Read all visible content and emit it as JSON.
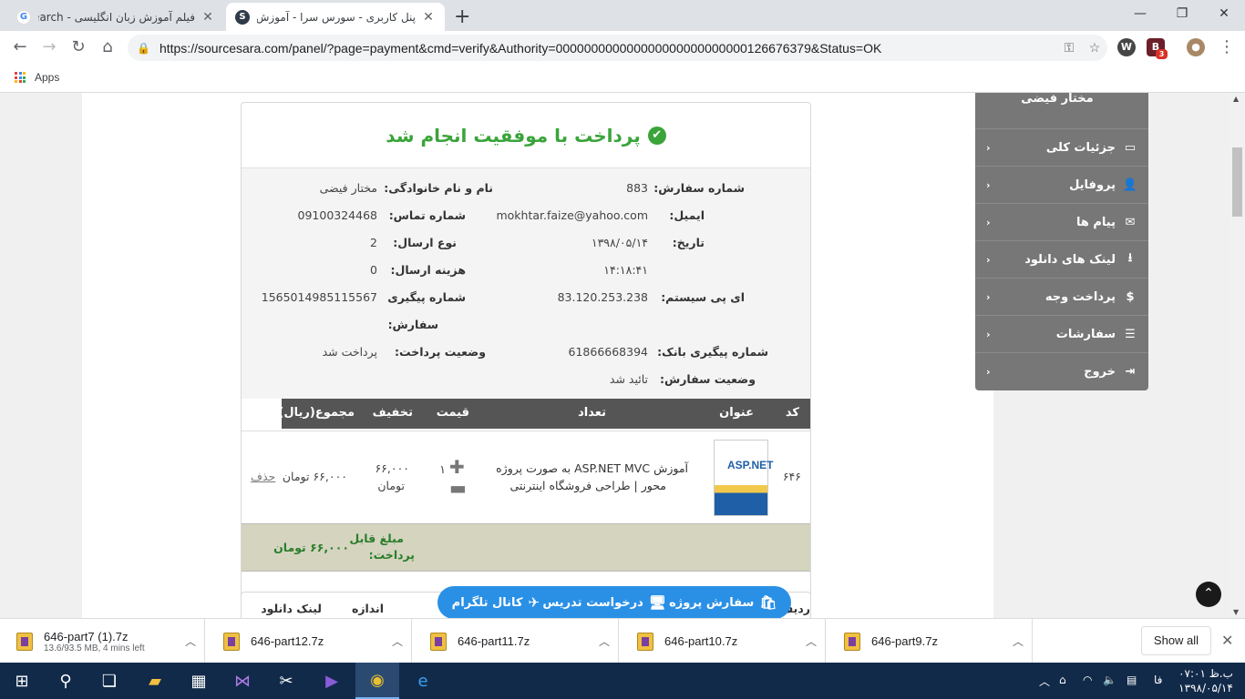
{
  "browser": {
    "tabs": [
      {
        "title": "فیلم آموزش زبان انگلیسی - Search",
        "icon": "google-icon"
      },
      {
        "title": "پنل کاربری - سورس سرا - آموزش برنامه نویسی",
        "icon": "sourcesara-icon"
      }
    ],
    "new_tab": "+",
    "url": "https://sourcesara.com/panel/?page=payment&cmd=verify&Authority=000000000000000000000000000126676379&Status=OK",
    "bookmarks_apps": "Apps",
    "ext_badge": "3"
  },
  "sidebar": {
    "user_name": "مختار فیضی",
    "items": [
      {
        "label": "جزئیات کلی",
        "icon": "card-icon"
      },
      {
        "label": "پروفایل",
        "icon": "user-plus-icon"
      },
      {
        "label": "پیام ها",
        "icon": "envelope-icon"
      },
      {
        "label": "لینک های دانلود",
        "icon": "download-icon"
      },
      {
        "label": "پرداخت وجه",
        "icon": "dollar-icon"
      },
      {
        "label": "سفارشات",
        "icon": "list-icon"
      },
      {
        "label": "خروج",
        "icon": "sign-out-icon"
      }
    ]
  },
  "payment": {
    "success_title": "پرداخت با موفقیت انجام شد",
    "fields_right": [
      {
        "label": "شماره سفارش:",
        "value": "883"
      },
      {
        "label": "ایمیل:",
        "value": "mokhtar.faize@yahoo.com"
      },
      {
        "label": "تاریخ:",
        "value": "۱۳۹۸/۰۵/۱۴"
      },
      {
        "label": "",
        "value": "۱۴:۱۸:۴۱"
      },
      {
        "label": "ای پی سیستم:",
        "value": "83.120.253.238"
      },
      {
        "label": "شماره پیگیری بانک:",
        "value": "61866668394"
      },
      {
        "label": "وضعیت سفارش:",
        "value": "تائید شد"
      }
    ],
    "fields_left": [
      {
        "label": "نام و نام خانوادگی:",
        "value": "مختار فیضی"
      },
      {
        "label": "شماره تماس:",
        "value": "09100324468"
      },
      {
        "label": "نوع ارسال:",
        "value": "2"
      },
      {
        "label": "هزینه ارسال:",
        "value": "0"
      },
      {
        "label": "شماره پیگیری",
        "value": "1565014985115567"
      },
      {
        "label": "سفارش:",
        "value": ""
      },
      {
        "label": "وضعیت پرداخت:",
        "value": "پرداخت شد"
      }
    ],
    "table_headers": [
      "کد",
      "عنوان",
      "تعداد",
      "قیمت",
      "تخفیف",
      "مجموع(ریال)"
    ],
    "row": {
      "code": "۶۴۶",
      "title_line1": "آموزش ASP.NET MVC به صورت پروژه",
      "title_line2": "محور | طراحی فروشگاه اینترنتی",
      "qty": "۱",
      "discount_line1": "۶۶,۰۰۰",
      "discount_line2": "تومان",
      "total": "۶۶,۰۰۰ تومان",
      "delete": "حذف",
      "img_text": "ASP.NET"
    },
    "payable_label_1": "مبلغ قابل",
    "payable_label_2": "پرداخت:",
    "payable_value": "۶۶,۰۰۰ تومان",
    "second_headers": [
      "ردیف",
      "اندازه",
      "لینک دانلود"
    ]
  },
  "actionbar": {
    "telegram": "کانال تلگرام",
    "teach": "درخواست تدریس",
    "project": "سفارش پروژه"
  },
  "downloads": {
    "items": [
      {
        "name": "646-part7 (1).7z",
        "sub": "13.6/93.5 MB, 4 mins left"
      },
      {
        "name": "646-part12.7z",
        "sub": ""
      },
      {
        "name": "646-part11.7z",
        "sub": ""
      },
      {
        "name": "646-part10.7z",
        "sub": ""
      },
      {
        "name": "646-part9.7z",
        "sub": ""
      }
    ],
    "show_all": "Show all"
  },
  "taskbar": {
    "lang": "فا",
    "time": "ب.ظ ۰۷:۰۱",
    "date": "۱۳۹۸/۰۵/۱۴"
  },
  "colors": {
    "success_green": "#3aa43a",
    "sidebar_gray": "#777777",
    "action_blue": "#2a90e6",
    "table_header": "#555555",
    "total_row": "#d4d4bf"
  }
}
